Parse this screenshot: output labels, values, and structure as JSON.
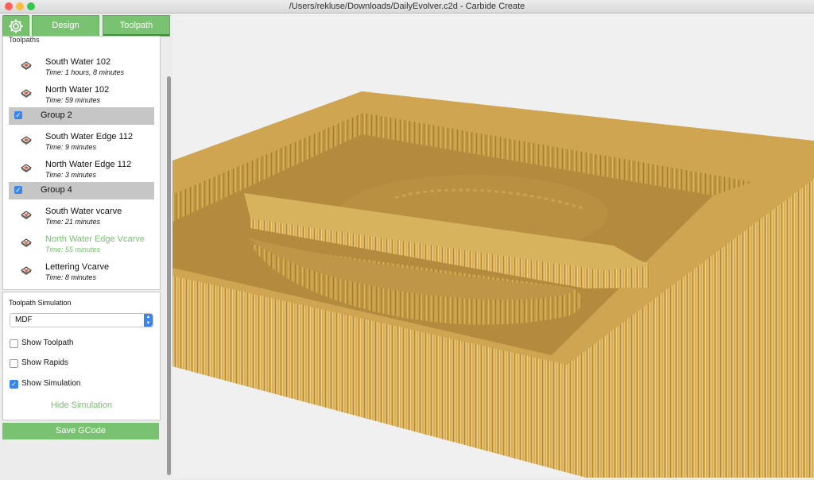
{
  "window": {
    "title": "/Users/rekluse/Downloads/DailyEvolver.c2d - Carbide Create",
    "traffic_lights": {
      "close": "#fc605c",
      "minimize": "#fdbc40",
      "zoom": "#34c84a"
    }
  },
  "toolbar": {
    "settings_icon": "gear-icon",
    "tabs": [
      {
        "label": "Design"
      },
      {
        "label": "Toolpath"
      }
    ],
    "active_tab": "Toolpath"
  },
  "toolpaths": {
    "title": "Toolpaths",
    "items": [
      {
        "type": "toolpath",
        "name": "South Water 102",
        "time": "Time: 1 hours, 8 minutes",
        "icon": "pocket-toolpath-icon"
      },
      {
        "type": "toolpath",
        "name": "North Water 102",
        "time": "Time: 59 minutes",
        "icon": "pocket-toolpath-icon"
      },
      {
        "type": "group",
        "name": "Group 2",
        "checked": true
      },
      {
        "type": "toolpath",
        "name": "South Water Edge 112",
        "time": "Time: 9 minutes",
        "icon": "pocket-toolpath-icon"
      },
      {
        "type": "toolpath",
        "name": "North Water Edge 112",
        "time": "Time: 3 minutes",
        "icon": "pocket-toolpath-icon"
      },
      {
        "type": "group",
        "name": "Group 4",
        "checked": true
      },
      {
        "type": "toolpath",
        "name": "South Water vcarve",
        "time": "Time: 21 minutes",
        "icon": "vcarve-toolpath-icon"
      },
      {
        "type": "toolpath",
        "name": "North Water Edge Vcarve",
        "time": "Time: 55 minutes",
        "icon": "vcarve-toolpath-icon",
        "active": true
      },
      {
        "type": "toolpath",
        "name": "Lettering Vcarve",
        "time": "Time: 8 minutes",
        "icon": "vcarve-toolpath-icon"
      }
    ]
  },
  "simulation": {
    "title": "Toolpath Simulation",
    "material": "MDF",
    "options": [
      {
        "label": "Show Toolpath",
        "checked": false
      },
      {
        "label": "Show Rapids",
        "checked": false
      },
      {
        "label": "Show Simulation",
        "checked": true
      }
    ],
    "hide_label": "Hide Simulation"
  },
  "save_label": "Save GCode",
  "colors": {
    "accent": "#77c16e",
    "checkbox": "#3a85e8",
    "wood_light": "#d9b45f",
    "wood_dark": "#b58d35"
  }
}
